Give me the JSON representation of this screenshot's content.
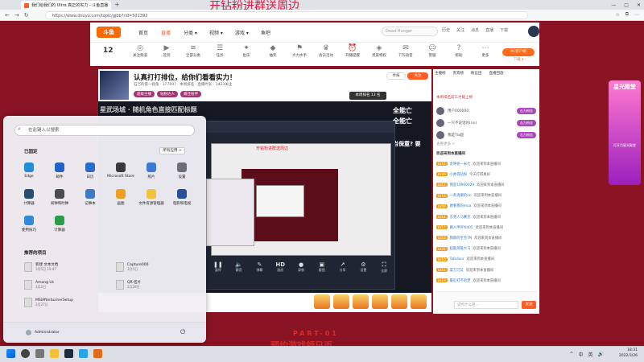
{
  "browser": {
    "tab_title": "我们给我们的 Ultra 真正的实力 - 斗鱼直播",
    "new_tab": "+",
    "url": "https://www.douyu.com/topic/gjbb?rid=501392",
    "window_controls": [
      "—",
      "▢",
      "✕"
    ],
    "nav": [
      "←",
      "→",
      "↻"
    ],
    "addr_right": [
      "☆",
      "⧉",
      "⋯"
    ]
  },
  "promo_text": "开钻粉进群送周边",
  "site": {
    "logo": "斗鱼",
    "nav": [
      "首页",
      "直播",
      "分类 ▾",
      "视频 ▾",
      "游戏 ▾",
      "鱼吧"
    ],
    "search_placeholder": "Dead Hunger",
    "header_icons": [
      "历史",
      "关注",
      "消息",
      "直播",
      "下载"
    ]
  },
  "categories": {
    "count": "12",
    "items": [
      "关注频道",
      "签到",
      "全部分类",
      "任务",
      "鱼乐",
      "抽奖",
      "大力水手",
      "会员活动",
      "开播提醒",
      "贵族特权",
      "TTS语音",
      "客服",
      "帮助",
      "更多"
    ],
    "pc_button": "PC客户端",
    "pc_sub": "下载 ▾"
  },
  "room": {
    "title": "认真打打排位，给你们看看实力！",
    "subtitle": "石万的第一视角 · 177697 · 本周排名 · 直播时长 · 1423关注",
    "tags": [
      "超级主播",
      "钻粉达人",
      "最佳陪伴"
    ],
    "report": "举报",
    "follow": "关注",
    "rank": "本周排名 13 名"
  },
  "video": {
    "overlay_left": "星武场城 · 随机角色直接匹配标题",
    "overlay_right1": "全能亡",
    "overlay_right2": "全能亡",
    "overlay_right3": "当保童? 要",
    "inner_promo": "开钻粉进群送周边",
    "controls": [
      "暂停",
      "静音",
      "弹幕",
      "画质",
      "录制",
      "截图",
      "分享",
      "设置",
      "全屏"
    ]
  },
  "panel": {
    "tabs": [
      "主播榜",
      "贵宾榜",
      "粉丝团",
      "直播回放"
    ],
    "info": "本周排名前三才能上榜",
    "ranks": [
      {
        "name": "用户000000",
        "tag": "石万粉丝"
      },
      {
        "name": "一只不说话的(nn)",
        "tag": "石万粉丝"
      },
      {
        "name": "我是Tia超",
        "tag": "石万粉丝"
      }
    ],
    "more": "查看更多 >",
    "chat_title": "欢迎来到本直播间",
    "chats": [
      {
        "lv": "LV15",
        "name": "金钟铭一米七",
        "msg": "欢迎来到本直播间"
      },
      {
        "lv": "LV20",
        "name": "小帅哥钻粉",
        "msg": "今天打得真好"
      },
      {
        "lv": "LV12",
        "name": "我是19960029",
        "msg": "欢迎来到本直播间"
      },
      {
        "lv": "LV18",
        "name": "一条清澈的nn",
        "msg": "欢迎来到本直播间"
      },
      {
        "lv": "LV09",
        "name": "她看我的mua",
        "msg": "欢迎来到本直播间"
      },
      {
        "lv": "LV14",
        "name": "东莞人马赛克",
        "msg": "欢迎来到本直播间"
      },
      {
        "lv": "LV11",
        "name": "路人甲PP0405",
        "msg": "欢迎来到本直播间"
      },
      {
        "lv": "LV16",
        "name": "颜颜的宝宝7N",
        "msg": "欢迎来到本直播间"
      },
      {
        "lv": "LV22",
        "name": "超能英雄大马",
        "msg": "欢迎来到本直播间"
      },
      {
        "lv": "LV10",
        "name": "Talkdoor",
        "msg": "欢迎来到本直播间"
      },
      {
        "lv": "LV13",
        "name": "菜刀刀又",
        "msg": "欢迎来到本直播间"
      },
      {
        "lv": "LV19",
        "name": "最近打不的梦",
        "msg": "欢迎来到本直播间"
      }
    ],
    "input_placeholder": "说点什么吧...",
    "send": "发送"
  },
  "banner": {
    "title": "星光殿堂",
    "sub": "打开月星光殿堂"
  },
  "part": {
    "label": "PART-01",
    "sub": "预约游戏领日币"
  },
  "start_menu": {
    "search_placeholder": "在此键入以搜索",
    "pinned_label": "已固定",
    "all_apps": "所有应用 >",
    "apps": [
      {
        "label": "Edge",
        "color": "#1f8fd8"
      },
      {
        "label": "邮件",
        "color": "#2064c8"
      },
      {
        "label": "日历",
        "color": "#2a6ad1"
      },
      {
        "label": "Microsoft Store",
        "color": "#3a3a3a"
      },
      {
        "label": "照片",
        "color": "#3d7ad6"
      },
      {
        "label": "设置",
        "color": "#6a6f7a"
      },
      {
        "label": "计算器",
        "color": "#2a4b74"
      },
      {
        "label": "闹钟和时钟",
        "color": "#4a4a52"
      },
      {
        "label": "记事本",
        "color": "#3f79c9"
      },
      {
        "label": "画图",
        "color": "#f0a020"
      },
      {
        "label": "文件资源管理器",
        "color": "#f2c23a"
      },
      {
        "label": "电影和电视",
        "color": "#284f9a"
      },
      {
        "label": "使用技巧",
        "color": "#2f8bd8"
      },
      {
        "label": "计算器",
        "color": "#2a9d4a"
      }
    ],
    "recommended_label": "推荐的项目",
    "recent": [
      {
        "name": "新建 文本文档",
        "sub": "3月5日 10:47"
      },
      {
        "name": "Capture000",
        "sub": "3月5日"
      },
      {
        "name": "Among Us",
        "sub": "3月2日"
      },
      {
        "name": "QR-名片",
        "sub": "2月28日"
      },
      {
        "name": "MSIAfterburnerSetup",
        "sub": "2月27日"
      }
    ],
    "user": "Administrator",
    "power": "⏻"
  },
  "taskbar": {
    "tray": [
      "^",
      "中",
      "英",
      "🔊"
    ],
    "time": "18:31",
    "date": "2022/3/26"
  }
}
